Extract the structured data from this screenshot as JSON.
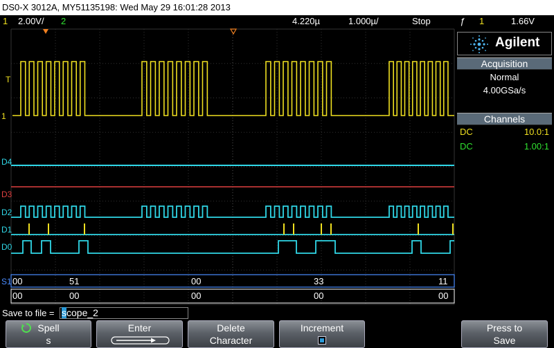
{
  "title_bar": {
    "text": "DS0-X 3012A, MY51135198: Wed May 29 16:01:28 2013"
  },
  "status": {
    "ch1_num": "1",
    "ch1_scale": "2.00V/",
    "ch2_num": "2",
    "time_ref": "4.220µ",
    "timebase": "1.000µ/",
    "run_state": "Stop",
    "trig_slope": "ƒ",
    "trig_source": "1",
    "trig_level": "1.66V"
  },
  "brand": {
    "name": "Agilent"
  },
  "acquisition": {
    "header": "Acquisition",
    "mode": "Normal",
    "rate": "4.00GSa/s"
  },
  "channels": {
    "header": "Channels",
    "rows": [
      {
        "coupling": "DC",
        "probe": "10.0:1",
        "color": "#f0e020"
      },
      {
        "coupling": "DC",
        "probe": "1.00:1",
        "color": "#30e030"
      }
    ]
  },
  "channel_labels": {
    "analog1": "1",
    "trig_marker": "T",
    "d4": "D4",
    "d3": "D3",
    "d2": "D2",
    "d1": "D1",
    "d0": "D0",
    "s1": "S1"
  },
  "serial_decode": {
    "row1": [
      "00",
      "51",
      "00",
      "33",
      "11"
    ],
    "row2": [
      "00",
      "00",
      "00",
      "00",
      "00"
    ]
  },
  "save": {
    "label": "Save to file =",
    "cursor_char": "s",
    "rest": "cope_2"
  },
  "softkeys": {
    "spell": {
      "line1": "Spell",
      "line2": "s"
    },
    "enter": {
      "line1": "Enter"
    },
    "delete": {
      "line1": "Delete",
      "line2": "Character"
    },
    "increment": {
      "line1": "Increment"
    },
    "press_to_save": {
      "line1": "Press to",
      "line2": "Save"
    }
  },
  "colors": {
    "ch1": "#f0e020",
    "ch2": "#30e030",
    "digital": "#30d8e8",
    "d3": "#e04040",
    "serial": "#4a8cff",
    "panel_header": "#5a6a78"
  }
}
